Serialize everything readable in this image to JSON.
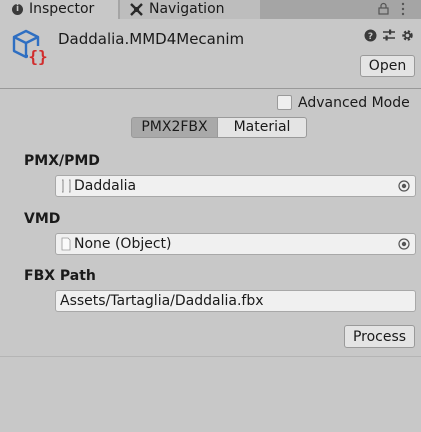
{
  "tabs": {
    "inspector_label": "Inspector",
    "inspector_icon": "info-icon",
    "navigation_label": "Navigation",
    "navigation_icon": "navigation-icon"
  },
  "header": {
    "title": "Daddalia.MMD4Mecanim",
    "icon": "script-object-icon",
    "open_label": "Open",
    "icons": [
      "help-icon",
      "presets-icon",
      "settings-icon"
    ]
  },
  "options": {
    "advanced_mode_label": "Advanced Mode",
    "advanced_mode_checked": false
  },
  "mode_tabs": {
    "items": [
      "PMX2FBX",
      "Material"
    ],
    "selected": "PMX2FBX"
  },
  "fields": {
    "pmx": {
      "label": "PMX/PMD",
      "value": "Daddalia"
    },
    "vmd": {
      "label": "VMD",
      "value": "None (Object)"
    },
    "fbx": {
      "label": "FBX Path",
      "value": "Assets/Tartaglia/Daddalia.fbx"
    }
  },
  "process_label": "Process",
  "colors": {
    "panel_bg": "#c8c8c8",
    "tabbar_bg": "#a5a5a5",
    "button_bg": "#e4e4e4",
    "field_bg": "#f0f0f0",
    "icon_blue": "#2f6fc2",
    "icon_red": "#d12c2c"
  }
}
